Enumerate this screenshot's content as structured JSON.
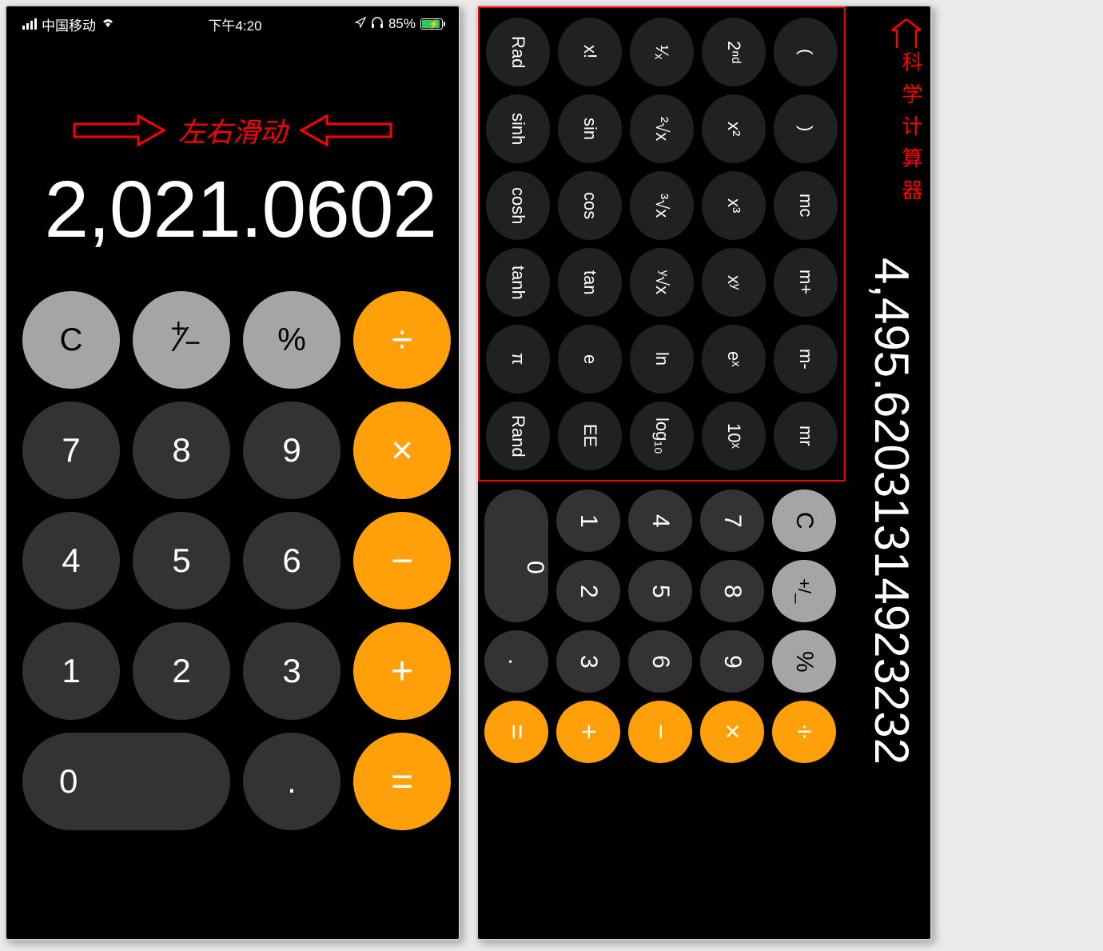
{
  "status": {
    "carrier": "中国移动",
    "time": "下午4:20",
    "battery_pct": "85%",
    "location_icon": "◤",
    "headphone_icon": "♫"
  },
  "portrait": {
    "swipe_hint": "左右滑动",
    "display": "2,021.0602",
    "buttons": {
      "c": "C",
      "pm": "+/_",
      "pct": "%",
      "div": "÷",
      "n7": "7",
      "n8": "8",
      "n9": "9",
      "mul": "×",
      "n4": "4",
      "n5": "5",
      "n6": "6",
      "sub": "−",
      "n1": "1",
      "n2": "2",
      "n3": "3",
      "add": "+",
      "n0": "0",
      "dot": ".",
      "eq": "="
    }
  },
  "landscape": {
    "label": "科学计算器",
    "display": "4,495.62031314923232",
    "sci": {
      "r1": [
        "Rad",
        "x!",
        "¹⁄ₓ",
        "2ⁿᵈ",
        "("
      ],
      "r2": [
        "sinh",
        "sin",
        "²√x",
        "x²",
        ")"
      ],
      "r3": [
        "cosh",
        "cos",
        "³√x",
        "x³",
        "mc"
      ],
      "r4": [
        "tanh",
        "tan",
        "ʸ√x",
        "xʸ",
        "m+"
      ],
      "r5": [
        "π",
        "e",
        "ln",
        "eˣ",
        "m-"
      ],
      "r6": [
        "Rand",
        "EE",
        "log₁₀",
        "10ˣ",
        "mr"
      ]
    },
    "num": {
      "r1": [
        "0",
        "1",
        "4",
        "7",
        "C"
      ],
      "r2_skip0": [
        "2",
        "5",
        "8",
        "+/_"
      ],
      "r3": [
        ".",
        "3",
        "6",
        "9",
        "%"
      ]
    },
    "ops": [
      "=",
      "+",
      "−",
      "×",
      "÷"
    ]
  }
}
